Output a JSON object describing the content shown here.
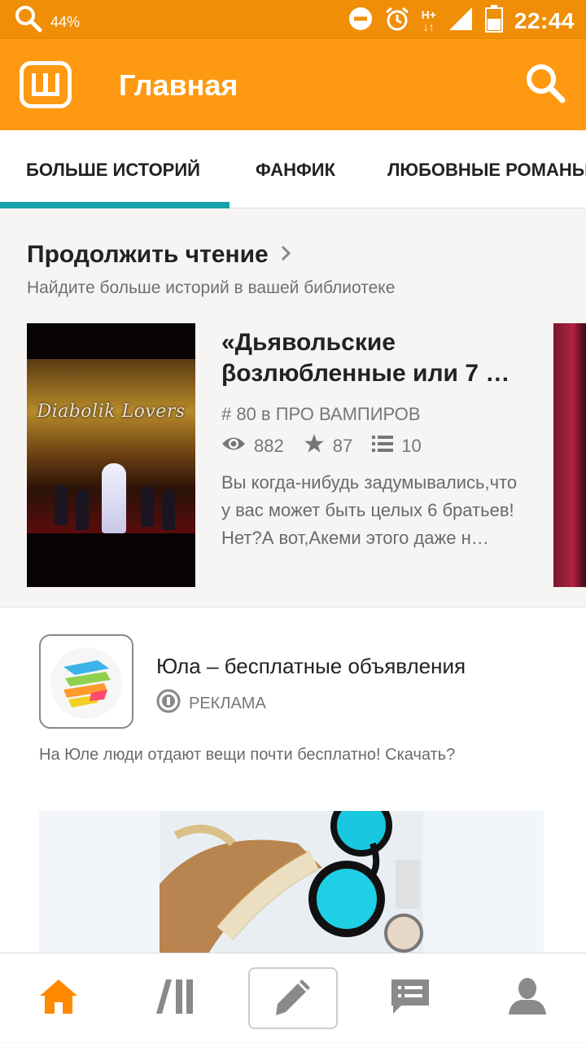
{
  "status_bar": {
    "battery_percent": "44%",
    "network": "H+",
    "time": "22:44"
  },
  "app_bar": {
    "title": "Главная"
  },
  "tabs": [
    {
      "label": "БОЛЬШЕ ИСТОРИЙ",
      "active": true
    },
    {
      "label": "ФАНФИК",
      "active": false
    },
    {
      "label": "ЛЮБОВНЫЕ РОМАНЫ",
      "active": false
    }
  ],
  "continue_reading": {
    "heading": "Продолжить чтение",
    "subheading": "Найдите больше историй в вашей библиотеке",
    "story": {
      "cover_text": "Diabolik Lovers",
      "title": "«Дьявольские βозлюбленные или 7 …",
      "rank": "# 80 в ПРО ВАМПИРОВ",
      "reads": "882",
      "votes": "87",
      "parts": "10",
      "description": "Вы когда-нибудь задумывались,что у вас может быть целых 6 братьев! Нет?А вот,Акеми этого даже н…"
    }
  },
  "ad": {
    "name": "Юла – бесплатные объявления",
    "label": "РЕКЛАМА",
    "description": "На Юле люди отдают вещи почти бесплатно! Скачать?"
  },
  "icons": {
    "accent": "#ff9912",
    "tab_indicator": "#17a3ad",
    "nav_active": "#ff8a00",
    "nav_inactive": "#8a8a8a"
  }
}
